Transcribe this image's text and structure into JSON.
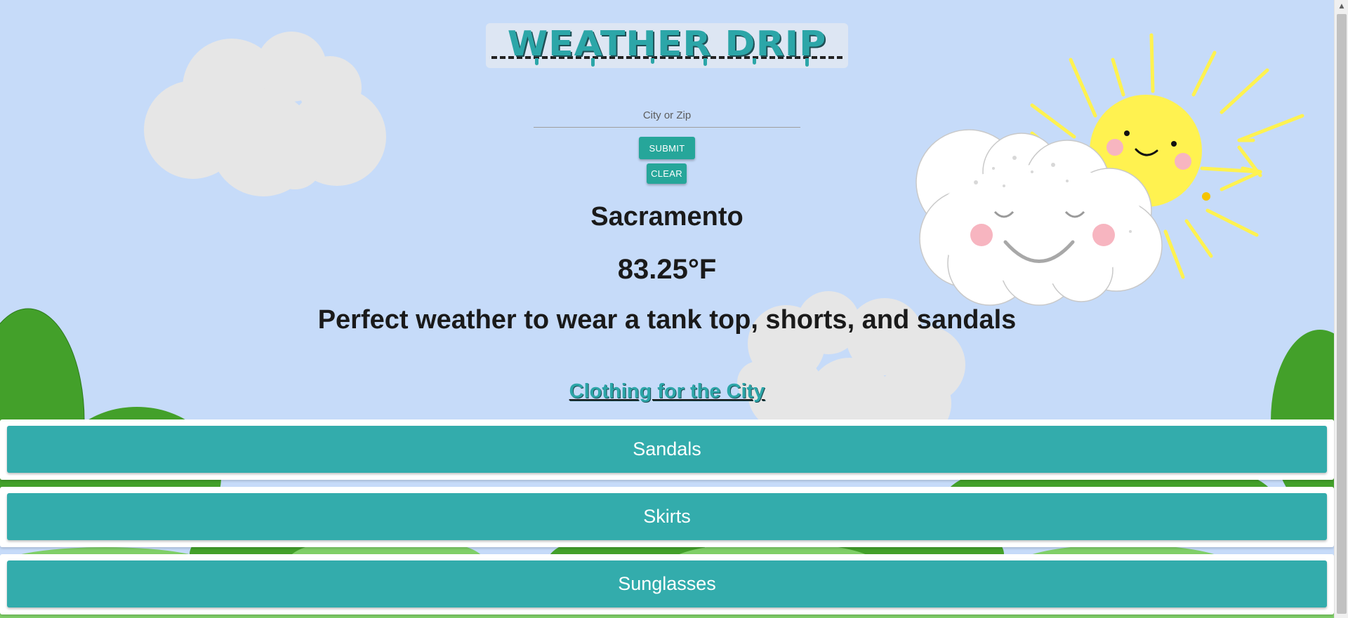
{
  "header": {
    "logo_text": "WEATHER DRIP"
  },
  "search": {
    "placeholder": "City or Zip",
    "value": "",
    "submit_label": "SUBMIT",
    "clear_label": "CLEAR"
  },
  "weather": {
    "city": "Sacramento",
    "temperature": "83.25°F",
    "advice": "Perfect weather to wear a tank top, shorts, and sandals"
  },
  "clothing": {
    "link_label": "Clothing for the City",
    "items": [
      {
        "label": "Sandals"
      },
      {
        "label": "Skirts"
      },
      {
        "label": "Sunglasses"
      }
    ]
  },
  "colors": {
    "sky": "#c6dbf9",
    "accent": "#26a69a",
    "item_bar": "#33acac",
    "hill_dark": "#43a02a",
    "hill_light": "#7fcf68",
    "sun": "#fff250",
    "cloud": "#e6e6e6"
  },
  "icons": {
    "sun": "smiling-sun-icon",
    "cloud": "smiling-cloud-icon"
  }
}
